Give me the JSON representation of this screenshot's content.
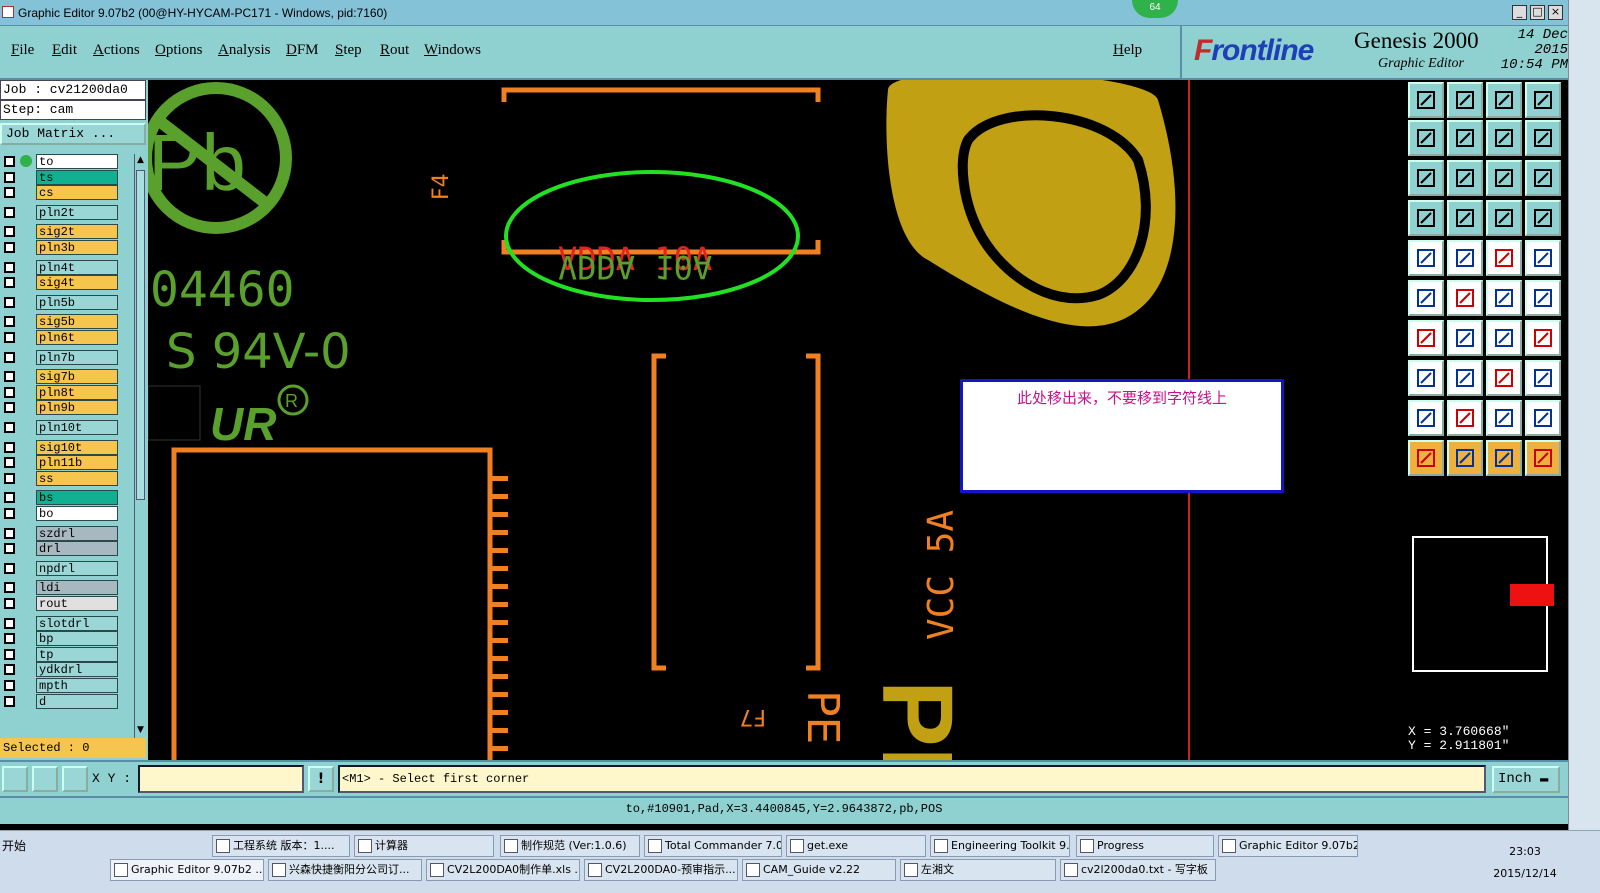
{
  "window": {
    "title": "Graphic Editor 9.07b2 (00@HY-HYCAM-PC171 - Windows, pid:7160)",
    "badge": "64",
    "min": "_",
    "max": "□",
    "close": "×"
  },
  "menu": {
    "items": [
      "File",
      "Edit",
      "Actions",
      "Options",
      "Analysis",
      "DFM",
      "Step",
      "Rout",
      "Windows"
    ],
    "help": "Help"
  },
  "brand": {
    "logo_f": "F",
    "logo_rest": "rontline",
    "product": "Genesis 2000",
    "subtitle": "Graphic Editor",
    "date": "14 Dec 2015",
    "time": "10:54 PM"
  },
  "job": {
    "job_line": "Job : cv21200da0",
    "step_line": "Step: cam",
    "matrix_button": "Job Matrix ..."
  },
  "layers": [
    {
      "name": "to",
      "color": "#ffffff",
      "active": true
    },
    {
      "name": "ts",
      "color": "#10b090"
    },
    {
      "name": "cs",
      "color": "#f5c54d"
    },
    {
      "name": "pln2t",
      "color": "#9ad6d6"
    },
    {
      "name": "sig2t",
      "color": "#f5c54d"
    },
    {
      "name": "pln3b",
      "color": "#f5c54d"
    },
    {
      "name": "pln4t",
      "color": "#9ad6d6"
    },
    {
      "name": "sig4t",
      "color": "#f5c54d"
    },
    {
      "name": "pln5b",
      "color": "#9ad6d6"
    },
    {
      "name": "sig5b",
      "color": "#f5c54d"
    },
    {
      "name": "pln6t",
      "color": "#f5c54d"
    },
    {
      "name": "pln7b",
      "color": "#9ad6d6"
    },
    {
      "name": "sig7b",
      "color": "#f5c54d"
    },
    {
      "name": "pln8t",
      "color": "#f5c54d"
    },
    {
      "name": "pln9b",
      "color": "#f5c54d"
    },
    {
      "name": "pln10t",
      "color": "#9ad6d6"
    },
    {
      "name": "sig10t",
      "color": "#f5c54d"
    },
    {
      "name": "pln11b",
      "color": "#f5c54d"
    },
    {
      "name": "ss",
      "color": "#f5c54d"
    },
    {
      "name": "bs",
      "color": "#10b090"
    },
    {
      "name": "bo",
      "color": "#ffffff"
    },
    {
      "name": "szdrl",
      "color": "#a8b8c0"
    },
    {
      "name": "drl",
      "color": "#a8b8c0"
    },
    {
      "name": "npdrl",
      "color": "#9ad6d6"
    },
    {
      "name": "ldi",
      "color": "#a8b8c0"
    },
    {
      "name": "rout",
      "color": "#e0e0e0"
    },
    {
      "name": "slotdrl",
      "color": "#9ad6d6"
    },
    {
      "name": "bp",
      "color": "#9ad6d6"
    },
    {
      "name": "tp",
      "color": "#9ad6d6"
    },
    {
      "name": "ydkdrl",
      "color": "#9ad6d6"
    },
    {
      "name": "mpth",
      "color": "#9ad6d6"
    },
    {
      "name": "d",
      "color": "#9ad6d6"
    }
  ],
  "selected": "Selected : 0",
  "canvas": {
    "silk_text_1": "VDDA 10A",
    "silk_text_2": "VDDA 10A",
    "label_f4": "F4",
    "label_04460": "04460",
    "label_94v0": "S 94V-0",
    "label_vcc": "VCC 5A",
    "label_pe": "PE",
    "label_f7": "F7",
    "label_pe_big": "PE",
    "note": "此处移出来，不要移到字符线上"
  },
  "coords": {
    "x": "X = 3.760668\"",
    "y": "Y = 2.911801\""
  },
  "command": {
    "xy_label": "X Y :",
    "xy_value": "",
    "bang": "!",
    "prompt": "<M1> - Select first corner",
    "unit": "Inch ▬"
  },
  "status": "to,#10901,Pad,X=3.4400845,Y=2.9643872,pb,POS",
  "taskbar": {
    "start": "开始",
    "row1": [
      "工程系统 版本：1....",
      "计算器",
      "制作规范 (Ver:1.0.6)",
      "Total Commander 7.0...",
      "get.exe",
      "Engineering Toolkit 9....",
      "Progress",
      "Graphic Editor 9.07b2..."
    ],
    "row2": [
      "Graphic Editor 9.07b2 ...",
      "兴森快捷衡阳分公司订...",
      "CV2L200DA0制作单.xls ...",
      "CV2L200DA0-预审指示...",
      "CAM_Guide v2.22",
      "左湘文",
      "cv2l200da0.txt - 写字板"
    ],
    "clock_time": "23:03",
    "clock_date": "2015/12/14"
  }
}
